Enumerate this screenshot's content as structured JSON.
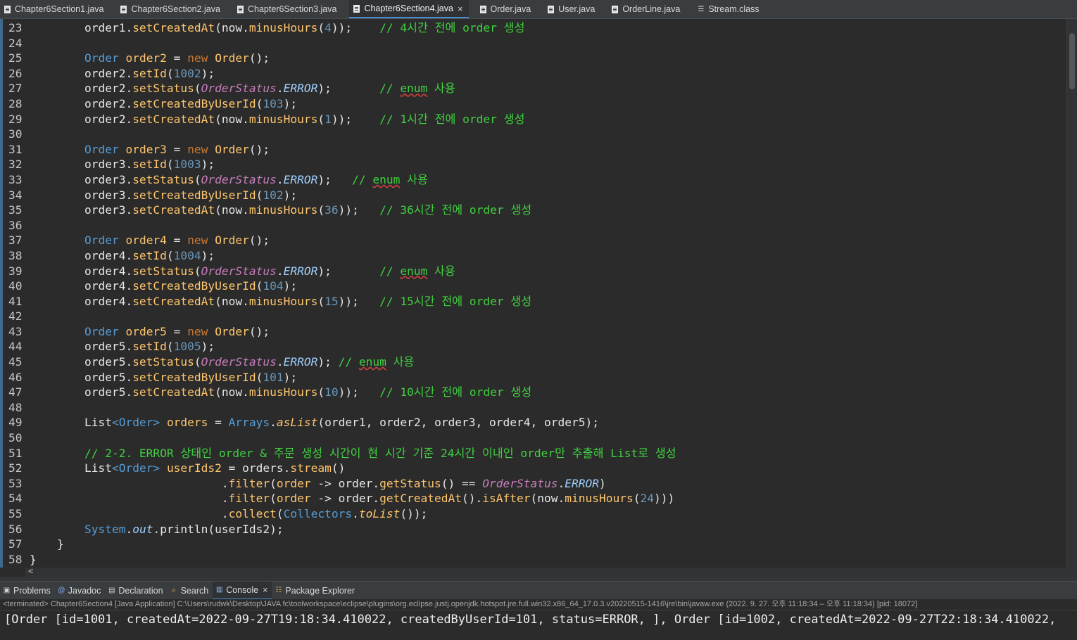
{
  "editor_tabs": [
    {
      "label": "Chapter6Section1.java",
      "icon": "java-file-icon"
    },
    {
      "label": "Chapter6Section2.java",
      "icon": "java-file-icon"
    },
    {
      "label": "Chapter6Section3.java",
      "icon": "java-file-icon"
    },
    {
      "label": "Chapter6Section4.java",
      "icon": "java-file-icon",
      "active": true,
      "close": "×"
    },
    {
      "label": "Order.java",
      "icon": "java-file-icon"
    },
    {
      "label": "User.java",
      "icon": "java-file-icon"
    },
    {
      "label": "OrderLine.java",
      "icon": "java-file-icon"
    },
    {
      "label": "Stream.class",
      "icon": "class-file-icon"
    }
  ],
  "code_lines": [
    {
      "n": "23",
      "t": [
        [
          "",
          "        order1."
        ],
        [
          "mt",
          "setCreatedAt"
        ],
        [
          "",
          "(now."
        ],
        [
          "mt",
          "minusHours"
        ],
        [
          "",
          "("
        ],
        [
          "num",
          "4"
        ],
        [
          "",
          "));    "
        ],
        [
          "cm",
          "// 4시간 전에 order 생성"
        ]
      ]
    },
    {
      "n": "24",
      "t": []
    },
    {
      "n": "25",
      "t": [
        [
          "",
          "        "
        ],
        [
          "ty",
          "Order"
        ],
        [
          "",
          " "
        ],
        [
          "mt",
          "order2"
        ],
        [
          "",
          " = "
        ],
        [
          "kw",
          "new"
        ],
        [
          "",
          " "
        ],
        [
          "mt",
          "Order"
        ],
        [
          "",
          "();"
        ]
      ]
    },
    {
      "n": "26",
      "t": [
        [
          "",
          "        order2."
        ],
        [
          "mt",
          "setId"
        ],
        [
          "",
          "("
        ],
        [
          "num",
          "1002"
        ],
        [
          "",
          ");"
        ]
      ]
    },
    {
      "n": "27",
      "t": [
        [
          "",
          "        order2."
        ],
        [
          "mt",
          "setStatus"
        ],
        [
          "",
          "("
        ],
        [
          "it",
          "OrderStatus"
        ],
        [
          "",
          "."
        ],
        [
          "cst",
          "ERROR"
        ],
        [
          "",
          ");       "
        ],
        [
          "cm",
          "// "
        ],
        [
          "cmsq",
          "enum"
        ],
        [
          "cm",
          " 사용"
        ]
      ]
    },
    {
      "n": "28",
      "t": [
        [
          "",
          "        order2."
        ],
        [
          "mt",
          "setCreatedByUserId"
        ],
        [
          "",
          "("
        ],
        [
          "num",
          "103"
        ],
        [
          "",
          ");"
        ]
      ]
    },
    {
      "n": "29",
      "t": [
        [
          "",
          "        order2."
        ],
        [
          "mt",
          "setCreatedAt"
        ],
        [
          "",
          "(now."
        ],
        [
          "mt",
          "minusHours"
        ],
        [
          "",
          "("
        ],
        [
          "num",
          "1"
        ],
        [
          "",
          "));    "
        ],
        [
          "cm",
          "// 1시간 전에 order 생성"
        ]
      ]
    },
    {
      "n": "30",
      "t": []
    },
    {
      "n": "31",
      "t": [
        [
          "",
          "        "
        ],
        [
          "ty",
          "Order"
        ],
        [
          "",
          " "
        ],
        [
          "mt",
          "order3"
        ],
        [
          "",
          " = "
        ],
        [
          "kw",
          "new"
        ],
        [
          "",
          " "
        ],
        [
          "mt",
          "Order"
        ],
        [
          "",
          "();"
        ]
      ]
    },
    {
      "n": "32",
      "t": [
        [
          "",
          "        order3."
        ],
        [
          "mt",
          "setId"
        ],
        [
          "",
          "("
        ],
        [
          "num",
          "1003"
        ],
        [
          "",
          ");"
        ]
      ]
    },
    {
      "n": "33",
      "t": [
        [
          "",
          "        order3."
        ],
        [
          "mt",
          "setStatus"
        ],
        [
          "",
          "("
        ],
        [
          "it",
          "OrderStatus"
        ],
        [
          "",
          "."
        ],
        [
          "cst",
          "ERROR"
        ],
        [
          "",
          ");   "
        ],
        [
          "cm",
          "// "
        ],
        [
          "cmsq",
          "enum"
        ],
        [
          "cm",
          " 사용"
        ]
      ]
    },
    {
      "n": "34",
      "t": [
        [
          "",
          "        order3."
        ],
        [
          "mt",
          "setCreatedByUserId"
        ],
        [
          "",
          "("
        ],
        [
          "num",
          "102"
        ],
        [
          "",
          ");"
        ]
      ]
    },
    {
      "n": "35",
      "t": [
        [
          "",
          "        order3."
        ],
        [
          "mt",
          "setCreatedAt"
        ],
        [
          "",
          "(now."
        ],
        [
          "mt",
          "minusHours"
        ],
        [
          "",
          "("
        ],
        [
          "num",
          "36"
        ],
        [
          "",
          "));   "
        ],
        [
          "cm",
          "// 36시간 전에 order 생성"
        ]
      ]
    },
    {
      "n": "36",
      "t": []
    },
    {
      "n": "37",
      "t": [
        [
          "",
          "        "
        ],
        [
          "ty",
          "Order"
        ],
        [
          "",
          " "
        ],
        [
          "mt",
          "order4"
        ],
        [
          "",
          " = "
        ],
        [
          "kw",
          "new"
        ],
        [
          "",
          " "
        ],
        [
          "mt",
          "Order"
        ],
        [
          "",
          "();"
        ]
      ]
    },
    {
      "n": "38",
      "t": [
        [
          "",
          "        order4."
        ],
        [
          "mt",
          "setId"
        ],
        [
          "",
          "("
        ],
        [
          "num",
          "1004"
        ],
        [
          "",
          ");"
        ]
      ]
    },
    {
      "n": "39",
      "t": [
        [
          "",
          "        order4."
        ],
        [
          "mt",
          "setStatus"
        ],
        [
          "",
          "("
        ],
        [
          "it",
          "OrderStatus"
        ],
        [
          "",
          "."
        ],
        [
          "cst",
          "ERROR"
        ],
        [
          "",
          ");       "
        ],
        [
          "cm",
          "// "
        ],
        [
          "cmsq",
          "enum"
        ],
        [
          "cm",
          " 사용"
        ]
      ]
    },
    {
      "n": "40",
      "t": [
        [
          "",
          "        order4."
        ],
        [
          "mt",
          "setCreatedByUserId"
        ],
        [
          "",
          "("
        ],
        [
          "num",
          "104"
        ],
        [
          "",
          ");"
        ]
      ]
    },
    {
      "n": "41",
      "t": [
        [
          "",
          "        order4."
        ],
        [
          "mt",
          "setCreatedAt"
        ],
        [
          "",
          "(now."
        ],
        [
          "mt",
          "minusHours"
        ],
        [
          "",
          "("
        ],
        [
          "num",
          "15"
        ],
        [
          "",
          "));   "
        ],
        [
          "cm",
          "// 15시간 전에 order 생성"
        ]
      ]
    },
    {
      "n": "42",
      "t": []
    },
    {
      "n": "43",
      "t": [
        [
          "",
          "        "
        ],
        [
          "ty",
          "Order"
        ],
        [
          "",
          " "
        ],
        [
          "mt",
          "order5"
        ],
        [
          "",
          " = "
        ],
        [
          "kw",
          "new"
        ],
        [
          "",
          " "
        ],
        [
          "mt",
          "Order"
        ],
        [
          "",
          "();"
        ]
      ]
    },
    {
      "n": "44",
      "t": [
        [
          "",
          "        order5."
        ],
        [
          "mt",
          "setId"
        ],
        [
          "",
          "("
        ],
        [
          "num",
          "1005"
        ],
        [
          "",
          ");"
        ]
      ]
    },
    {
      "n": "45",
      "t": [
        [
          "",
          "        order5."
        ],
        [
          "mt",
          "setStatus"
        ],
        [
          "",
          "("
        ],
        [
          "it",
          "OrderStatus"
        ],
        [
          "",
          "."
        ],
        [
          "cst",
          "ERROR"
        ],
        [
          "",
          "); "
        ],
        [
          "cm",
          "// "
        ],
        [
          "cmsq",
          "enum"
        ],
        [
          "cm",
          " 사용"
        ]
      ]
    },
    {
      "n": "46",
      "t": [
        [
          "",
          "        order5."
        ],
        [
          "mt",
          "setCreatedByUserId"
        ],
        [
          "",
          "("
        ],
        [
          "num",
          "101"
        ],
        [
          "",
          ");"
        ]
      ]
    },
    {
      "n": "47",
      "t": [
        [
          "",
          "        order5."
        ],
        [
          "mt",
          "setCreatedAt"
        ],
        [
          "",
          "(now."
        ],
        [
          "mt",
          "minusHours"
        ],
        [
          "",
          "("
        ],
        [
          "num",
          "10"
        ],
        [
          "",
          "));   "
        ],
        [
          "cm",
          "// 10시간 전에 order 생성"
        ]
      ]
    },
    {
      "n": "48",
      "t": []
    },
    {
      "n": "49",
      "t": [
        [
          "",
          "        "
        ],
        [
          "mt2",
          "List"
        ],
        [
          "ty",
          "<Order>"
        ],
        [
          "",
          " "
        ],
        [
          "mt",
          "orders"
        ],
        [
          "",
          " = "
        ],
        [
          "cls",
          "Arrays"
        ],
        [
          "",
          "."
        ],
        [
          "itm",
          "asList"
        ],
        [
          "",
          "(order1, order2, order3, order4, order5);"
        ]
      ]
    },
    {
      "n": "50",
      "t": []
    },
    {
      "n": "51",
      "t": [
        [
          "",
          "        "
        ],
        [
          "cm",
          "// 2-2. ERROR 상태인 order & 주문 생성 시간이 현 시간 기준 24시간 이내인 order만 추출해 List로 생성"
        ]
      ]
    },
    {
      "n": "52",
      "t": [
        [
          "",
          "        "
        ],
        [
          "mt2",
          "List"
        ],
        [
          "ty",
          "<Order>"
        ],
        [
          "",
          " "
        ],
        [
          "mt",
          "userIds2"
        ],
        [
          "",
          " = orders."
        ],
        [
          "mt",
          "stream"
        ],
        [
          "",
          "()"
        ]
      ]
    },
    {
      "n": "53",
      "t": [
        [
          "",
          "                            ."
        ],
        [
          "mt",
          "filter"
        ],
        [
          "",
          "("
        ],
        [
          "mt",
          "order"
        ],
        [
          "",
          " -> order."
        ],
        [
          "mt",
          "getStatus"
        ],
        [
          "",
          "() == "
        ],
        [
          "it",
          "OrderStatus"
        ],
        [
          "",
          "."
        ],
        [
          "cst",
          "ERROR"
        ],
        [
          "",
          ")"
        ]
      ]
    },
    {
      "n": "54",
      "t": [
        [
          "",
          "                            ."
        ],
        [
          "mt",
          "filter"
        ],
        [
          "",
          "("
        ],
        [
          "mt",
          "order"
        ],
        [
          "",
          " -> order."
        ],
        [
          "mt",
          "getCreatedAt"
        ],
        [
          "",
          "()."
        ],
        [
          "mt",
          "isAfter"
        ],
        [
          "",
          "(now."
        ],
        [
          "mt",
          "minusHours"
        ],
        [
          "",
          "("
        ],
        [
          "num",
          "24"
        ],
        [
          "",
          ")))"
        ]
      ]
    },
    {
      "n": "55",
      "t": [
        [
          "",
          "                            ."
        ],
        [
          "mt",
          "collect"
        ],
        [
          "",
          "("
        ],
        [
          "cls",
          "Collectors"
        ],
        [
          "",
          "."
        ],
        [
          "itm",
          "toList"
        ],
        [
          "",
          "());"
        ]
      ]
    },
    {
      "n": "56",
      "t": [
        [
          "",
          "        "
        ],
        [
          "cls",
          "System"
        ],
        [
          "",
          "."
        ],
        [
          "cst",
          "out"
        ],
        [
          "",
          ".println(userIds2);"
        ]
      ]
    },
    {
      "n": "57",
      "t": [
        [
          "",
          "    }"
        ]
      ]
    },
    {
      "n": "58",
      "t": [
        [
          "",
          "}"
        ]
      ]
    }
  ],
  "panel_tabs": [
    {
      "label": "Problems",
      "icon": "problems-icon"
    },
    {
      "label": "Javadoc",
      "icon": "javadoc-icon"
    },
    {
      "label": "Declaration",
      "icon": "declaration-icon"
    },
    {
      "label": "Search",
      "icon": "search-icon"
    },
    {
      "label": "Console",
      "icon": "console-icon",
      "active": true,
      "close": "×"
    },
    {
      "label": "Package Explorer",
      "icon": "package-explorer-icon"
    }
  ],
  "console": {
    "status": "<terminated> Chapter6Section4 [Java Application] C:\\Users\\rudwk\\Desktop\\JAVA fc\\toolworkspace\\eclipse\\plugins\\org.eclipse.justj.openjdk.hotspot.jre.full.win32.x86_64_17.0.3.v20220515-1416\\jre\\bin\\javaw.exe  (2022. 9. 27. 오후 11:18:34 – 오후 11:18:34) [pid: 18072]",
    "output": "[Order [id=1001, createdAt=2022-09-27T19:18:34.410022, createdByUserId=101, status=ERROR, ], Order [id=1002, createdAt=2022-09-27T22:18:34.410022,"
  },
  "scroll_arrow": "<"
}
